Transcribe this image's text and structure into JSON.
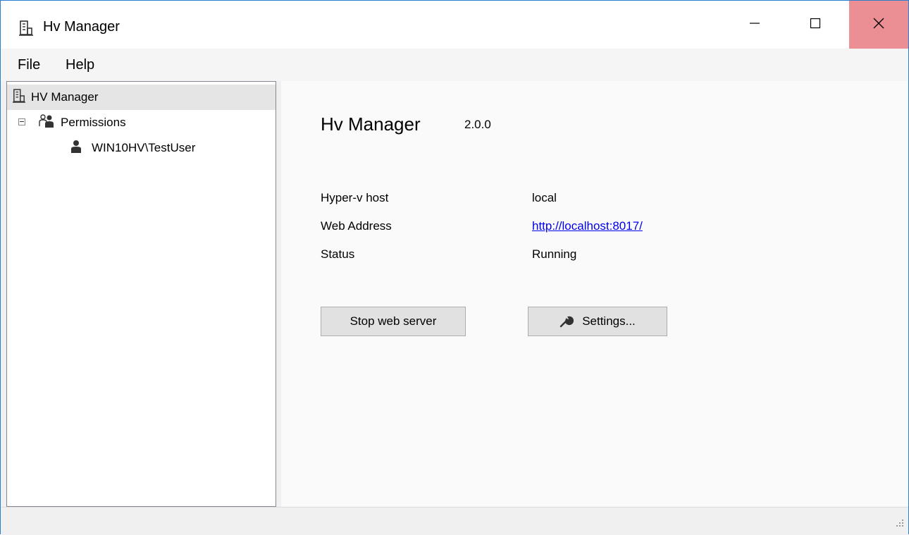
{
  "window": {
    "title": "Hv Manager",
    "app_icon": "building-icon"
  },
  "controls": {
    "minimize_icon": "minimize-icon",
    "maximize_icon": "maximize-icon",
    "close_icon": "close-icon",
    "close_bg": "#ec8f94"
  },
  "menu": {
    "items": [
      {
        "label": "File"
      },
      {
        "label": "Help"
      }
    ]
  },
  "tree": {
    "root": {
      "label": "HV Manager",
      "icon": "building-icon",
      "selected": true
    },
    "permissions": {
      "label": "Permissions",
      "icon": "users-icon",
      "expanded": true
    },
    "user": {
      "label": "WIN10HV\\TestUser",
      "icon": "user-icon"
    }
  },
  "main": {
    "app_name": "Hv Manager",
    "version": "2.0.0",
    "fields": [
      {
        "label": "Hyper-v host",
        "value": "local"
      },
      {
        "label": "Web Address",
        "value": "http://localhost:8017/",
        "is_link": true
      },
      {
        "label": "Status",
        "value": "Running"
      }
    ],
    "buttons": {
      "stop_label": "Stop web server",
      "settings_label": "Settings...",
      "settings_icon": "wrench-icon"
    }
  },
  "colors": {
    "link": "#0000ee",
    "selection": "#e5e5e5",
    "window_border": "#2b7fd1"
  }
}
